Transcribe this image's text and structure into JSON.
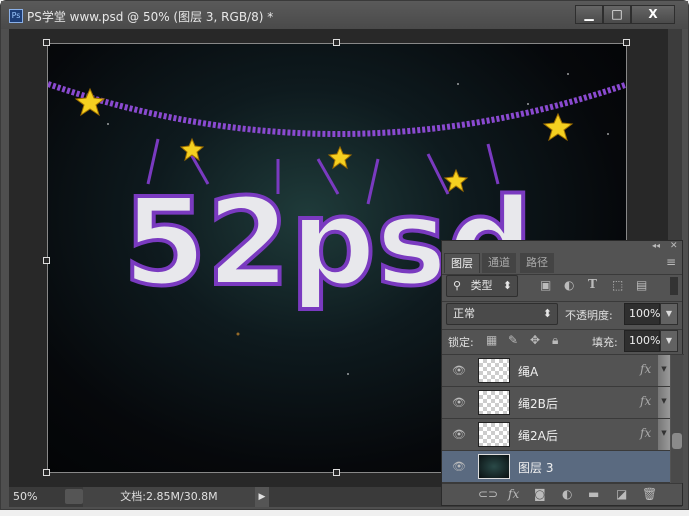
{
  "window": {
    "title": "PS学堂 www.psd @ 50% (图层 3, RGB/8) *",
    "app_icon": "Ps",
    "minimize": "▁",
    "maximize": "□",
    "close": "X"
  },
  "canvas": {
    "artwork_text": "52psd"
  },
  "status": {
    "zoom": "50%",
    "doc_info": "文档:2.85M/30.8M",
    "arrow": "▶"
  },
  "panel": {
    "collapse": "◂◂",
    "close": "✕",
    "menu": "≡",
    "tabs": [
      {
        "label": "图层"
      },
      {
        "label": "通道"
      },
      {
        "label": "路径"
      }
    ],
    "filter": {
      "label": "类型",
      "search_icon": "⚲",
      "arrows": "⬍"
    },
    "filter_icons": [
      "image-icon",
      "adjustment-icon",
      "type-icon",
      "shape-icon",
      "smart-object-icon"
    ],
    "blend_mode": "正常",
    "opacity_label": "不透明度:",
    "opacity": "100%",
    "lock_label": "锁定:",
    "fill_label": "填充:",
    "fill": "100%",
    "layers": [
      {
        "name": "绳A",
        "fx": "fx"
      },
      {
        "name": "绳2B后",
        "fx": "fx"
      },
      {
        "name": "绳2A后",
        "fx": "fx"
      },
      {
        "name": "图层 3",
        "selected": true
      }
    ],
    "footer_icons": [
      "link-icon",
      "fx-icon",
      "mask-icon",
      "adjustment-icon",
      "folder-icon",
      "new-layer-icon",
      "trash-icon"
    ]
  }
}
